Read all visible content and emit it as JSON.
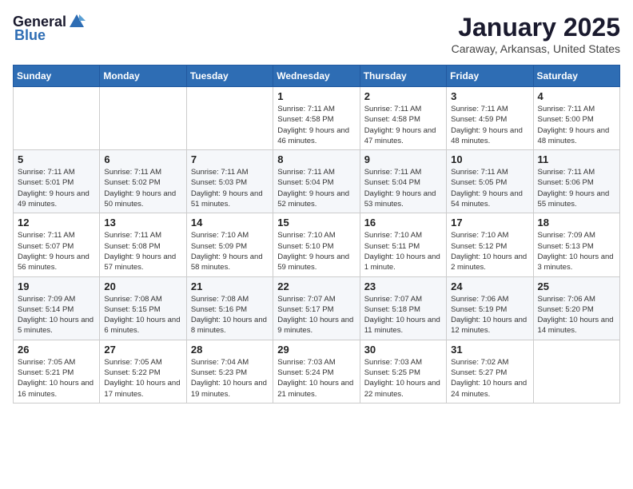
{
  "logo": {
    "general": "General",
    "blue": "Blue"
  },
  "title": "January 2025",
  "subtitle": "Caraway, Arkansas, United States",
  "days_of_week": [
    "Sunday",
    "Monday",
    "Tuesday",
    "Wednesday",
    "Thursday",
    "Friday",
    "Saturday"
  ],
  "weeks": [
    [
      {
        "day": "",
        "info": ""
      },
      {
        "day": "",
        "info": ""
      },
      {
        "day": "",
        "info": ""
      },
      {
        "day": "1",
        "info": "Sunrise: 7:11 AM\nSunset: 4:58 PM\nDaylight: 9 hours and 46 minutes."
      },
      {
        "day": "2",
        "info": "Sunrise: 7:11 AM\nSunset: 4:58 PM\nDaylight: 9 hours and 47 minutes."
      },
      {
        "day": "3",
        "info": "Sunrise: 7:11 AM\nSunset: 4:59 PM\nDaylight: 9 hours and 48 minutes."
      },
      {
        "day": "4",
        "info": "Sunrise: 7:11 AM\nSunset: 5:00 PM\nDaylight: 9 hours and 48 minutes."
      }
    ],
    [
      {
        "day": "5",
        "info": "Sunrise: 7:11 AM\nSunset: 5:01 PM\nDaylight: 9 hours and 49 minutes."
      },
      {
        "day": "6",
        "info": "Sunrise: 7:11 AM\nSunset: 5:02 PM\nDaylight: 9 hours and 50 minutes."
      },
      {
        "day": "7",
        "info": "Sunrise: 7:11 AM\nSunset: 5:03 PM\nDaylight: 9 hours and 51 minutes."
      },
      {
        "day": "8",
        "info": "Sunrise: 7:11 AM\nSunset: 5:04 PM\nDaylight: 9 hours and 52 minutes."
      },
      {
        "day": "9",
        "info": "Sunrise: 7:11 AM\nSunset: 5:04 PM\nDaylight: 9 hours and 53 minutes."
      },
      {
        "day": "10",
        "info": "Sunrise: 7:11 AM\nSunset: 5:05 PM\nDaylight: 9 hours and 54 minutes."
      },
      {
        "day": "11",
        "info": "Sunrise: 7:11 AM\nSunset: 5:06 PM\nDaylight: 9 hours and 55 minutes."
      }
    ],
    [
      {
        "day": "12",
        "info": "Sunrise: 7:11 AM\nSunset: 5:07 PM\nDaylight: 9 hours and 56 minutes."
      },
      {
        "day": "13",
        "info": "Sunrise: 7:11 AM\nSunset: 5:08 PM\nDaylight: 9 hours and 57 minutes."
      },
      {
        "day": "14",
        "info": "Sunrise: 7:10 AM\nSunset: 5:09 PM\nDaylight: 9 hours and 58 minutes."
      },
      {
        "day": "15",
        "info": "Sunrise: 7:10 AM\nSunset: 5:10 PM\nDaylight: 9 hours and 59 minutes."
      },
      {
        "day": "16",
        "info": "Sunrise: 7:10 AM\nSunset: 5:11 PM\nDaylight: 10 hours and 1 minute."
      },
      {
        "day": "17",
        "info": "Sunrise: 7:10 AM\nSunset: 5:12 PM\nDaylight: 10 hours and 2 minutes."
      },
      {
        "day": "18",
        "info": "Sunrise: 7:09 AM\nSunset: 5:13 PM\nDaylight: 10 hours and 3 minutes."
      }
    ],
    [
      {
        "day": "19",
        "info": "Sunrise: 7:09 AM\nSunset: 5:14 PM\nDaylight: 10 hours and 5 minutes."
      },
      {
        "day": "20",
        "info": "Sunrise: 7:08 AM\nSunset: 5:15 PM\nDaylight: 10 hours and 6 minutes."
      },
      {
        "day": "21",
        "info": "Sunrise: 7:08 AM\nSunset: 5:16 PM\nDaylight: 10 hours and 8 minutes."
      },
      {
        "day": "22",
        "info": "Sunrise: 7:07 AM\nSunset: 5:17 PM\nDaylight: 10 hours and 9 minutes."
      },
      {
        "day": "23",
        "info": "Sunrise: 7:07 AM\nSunset: 5:18 PM\nDaylight: 10 hours and 11 minutes."
      },
      {
        "day": "24",
        "info": "Sunrise: 7:06 AM\nSunset: 5:19 PM\nDaylight: 10 hours and 12 minutes."
      },
      {
        "day": "25",
        "info": "Sunrise: 7:06 AM\nSunset: 5:20 PM\nDaylight: 10 hours and 14 minutes."
      }
    ],
    [
      {
        "day": "26",
        "info": "Sunrise: 7:05 AM\nSunset: 5:21 PM\nDaylight: 10 hours and 16 minutes."
      },
      {
        "day": "27",
        "info": "Sunrise: 7:05 AM\nSunset: 5:22 PM\nDaylight: 10 hours and 17 minutes."
      },
      {
        "day": "28",
        "info": "Sunrise: 7:04 AM\nSunset: 5:23 PM\nDaylight: 10 hours and 19 minutes."
      },
      {
        "day": "29",
        "info": "Sunrise: 7:03 AM\nSunset: 5:24 PM\nDaylight: 10 hours and 21 minutes."
      },
      {
        "day": "30",
        "info": "Sunrise: 7:03 AM\nSunset: 5:25 PM\nDaylight: 10 hours and 22 minutes."
      },
      {
        "day": "31",
        "info": "Sunrise: 7:02 AM\nSunset: 5:27 PM\nDaylight: 10 hours and 24 minutes."
      },
      {
        "day": "",
        "info": ""
      }
    ]
  ]
}
